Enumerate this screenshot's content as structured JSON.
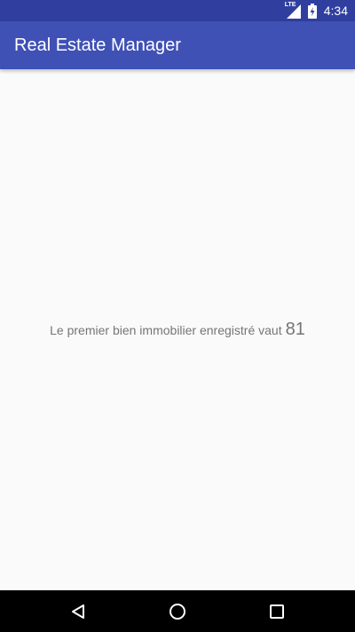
{
  "status_bar": {
    "network_label": "LTE",
    "signal_icon": "signal-icon",
    "battery_icon": "battery-charging-icon",
    "time": "4:34",
    "background_color": "#303F9F"
  },
  "app_bar": {
    "title": "Real Estate Manager",
    "background_color": "#3F51B5"
  },
  "main": {
    "message": "Le premier bien immobilier enregistré vaut",
    "value": "81"
  },
  "nav_bar": {
    "back_icon": "back-triangle-icon",
    "home_icon": "home-circle-icon",
    "recents_icon": "recents-square-icon"
  }
}
